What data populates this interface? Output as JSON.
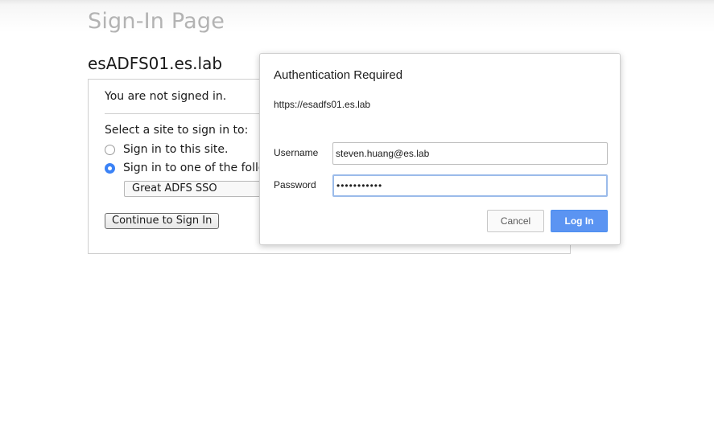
{
  "page": {
    "title": "Sign-In Page",
    "server_name": "esADFS01.es.lab"
  },
  "signin_box": {
    "status_text": "You are not signed in.",
    "select_prompt": "Select a site to sign in to:",
    "options": [
      {
        "label": "Sign in to this site.",
        "checked": false
      },
      {
        "label": "Sign in to one of the follow",
        "checked": true
      }
    ],
    "site_select_value": "Great ADFS SSO",
    "continue_label": "Continue to Sign In"
  },
  "dialog": {
    "title": "Authentication Required",
    "url": "https://esadfs01.es.lab",
    "username_label": "Username",
    "username_value": "steven.huang@es.lab",
    "password_label": "Password",
    "password_value": "•••••••••••",
    "cancel_label": "Cancel",
    "login_label": "Log In"
  },
  "colors": {
    "accent": "#5b94f2",
    "title_gray": "#b3b3b3",
    "focus_border": "#9bbbea"
  }
}
